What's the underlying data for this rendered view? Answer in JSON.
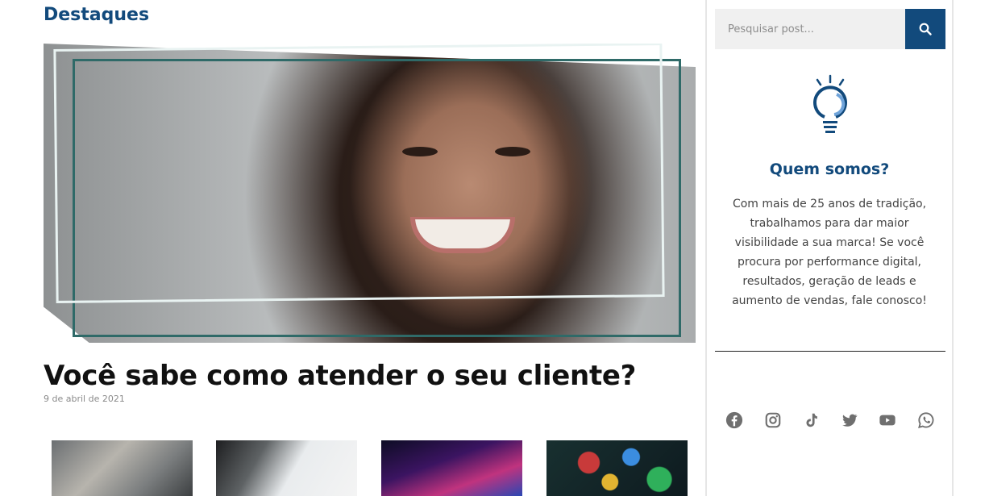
{
  "main": {
    "section_title": "Destaques",
    "featured_post": {
      "title": "Você sabe como atender o seu cliente?",
      "date": "9 de abril de 2021",
      "image_icon": "portrait-smiling-woman-image"
    },
    "thumbnails": [
      {
        "icon": "laptop-meeting-image"
      },
      {
        "icon": "tablet-charts-image"
      },
      {
        "icon": "neon-desk-image"
      },
      {
        "icon": "social-media-icons-image"
      }
    ]
  },
  "sidebar": {
    "search": {
      "placeholder": "Pesquisar post...",
      "button_icon": "search-icon"
    },
    "about": {
      "icon": "lightbulb-icon",
      "title": "Quem somos?",
      "text": "Com mais de 25 anos de tradição, trabalhamos para dar maior visibilidade a sua marca! Se você procura por performance digital, resultados, geração de leads e aumento de vendas, fale conosco!"
    },
    "social_icons": [
      "facebook-icon",
      "instagram-icon",
      "tiktok-icon",
      "twitter-icon",
      "youtube-icon",
      "whatsapp-icon"
    ]
  },
  "colors": {
    "accent": "#124a7c",
    "icon_gray": "#6f6f6f",
    "frame": "#2f6a68"
  }
}
